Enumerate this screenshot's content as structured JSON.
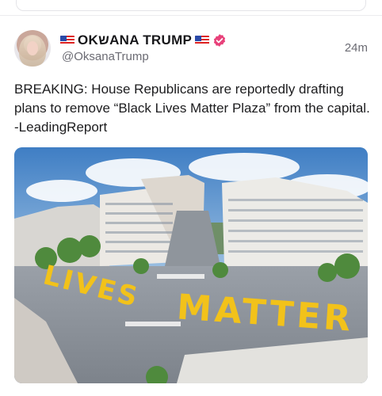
{
  "post": {
    "author": {
      "display_name": "OKשANA TRUMP",
      "handle": "@OksanaTrump",
      "flag_icon": "us-flag-icon",
      "verified_color": "#e8417a"
    },
    "timestamp": "24m",
    "text": "BREAKING: House Republicans are reportedly drafting plans to remove “Black Lives Matter Plaza” from the capital. -LeadingReport",
    "image": {
      "painted_words": [
        "LIVES",
        "MATTER"
      ]
    }
  }
}
